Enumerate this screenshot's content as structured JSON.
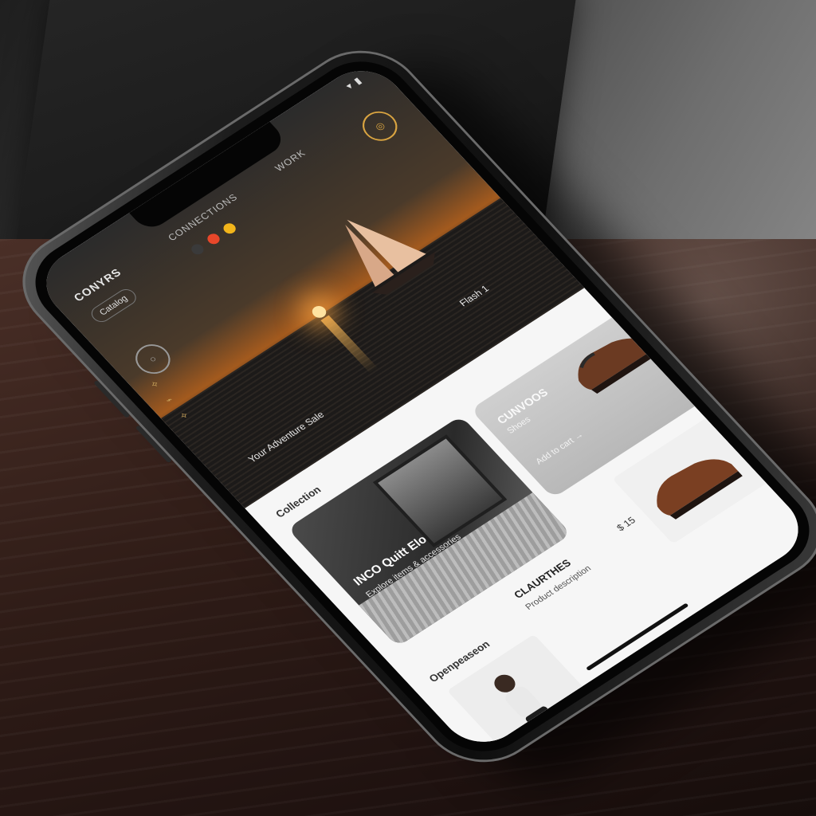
{
  "app": {
    "brand": "CONYRS",
    "nav_links": [
      "CONNECTIONS",
      "WORK"
    ],
    "menu_chip": "Catalog"
  },
  "hero": {
    "caption_left": "Your Adventure Sale",
    "caption_right": "Flash 1"
  },
  "sections": {
    "collections_label": "Collection",
    "collections_dark_title": "INCO Quitt Elo",
    "collections_dark_text": "Explore items & accessories",
    "collections_light_title": "CUNVOOS",
    "collections_light_sub": "Shoes",
    "collections_light_text": "Add to cart →",
    "products_label": "Openpeaseon",
    "product_title": "CLAURTHES",
    "product_text": "Product description",
    "product_price": "$ 15"
  },
  "colors": {
    "accent_red": "#e8472a",
    "accent_yellow": "#f2b51b",
    "accent_gold": "#d9a441"
  },
  "icons": [
    "wifi-icon",
    "battery-icon",
    "circle-icon",
    "chevron-right-icon"
  ]
}
